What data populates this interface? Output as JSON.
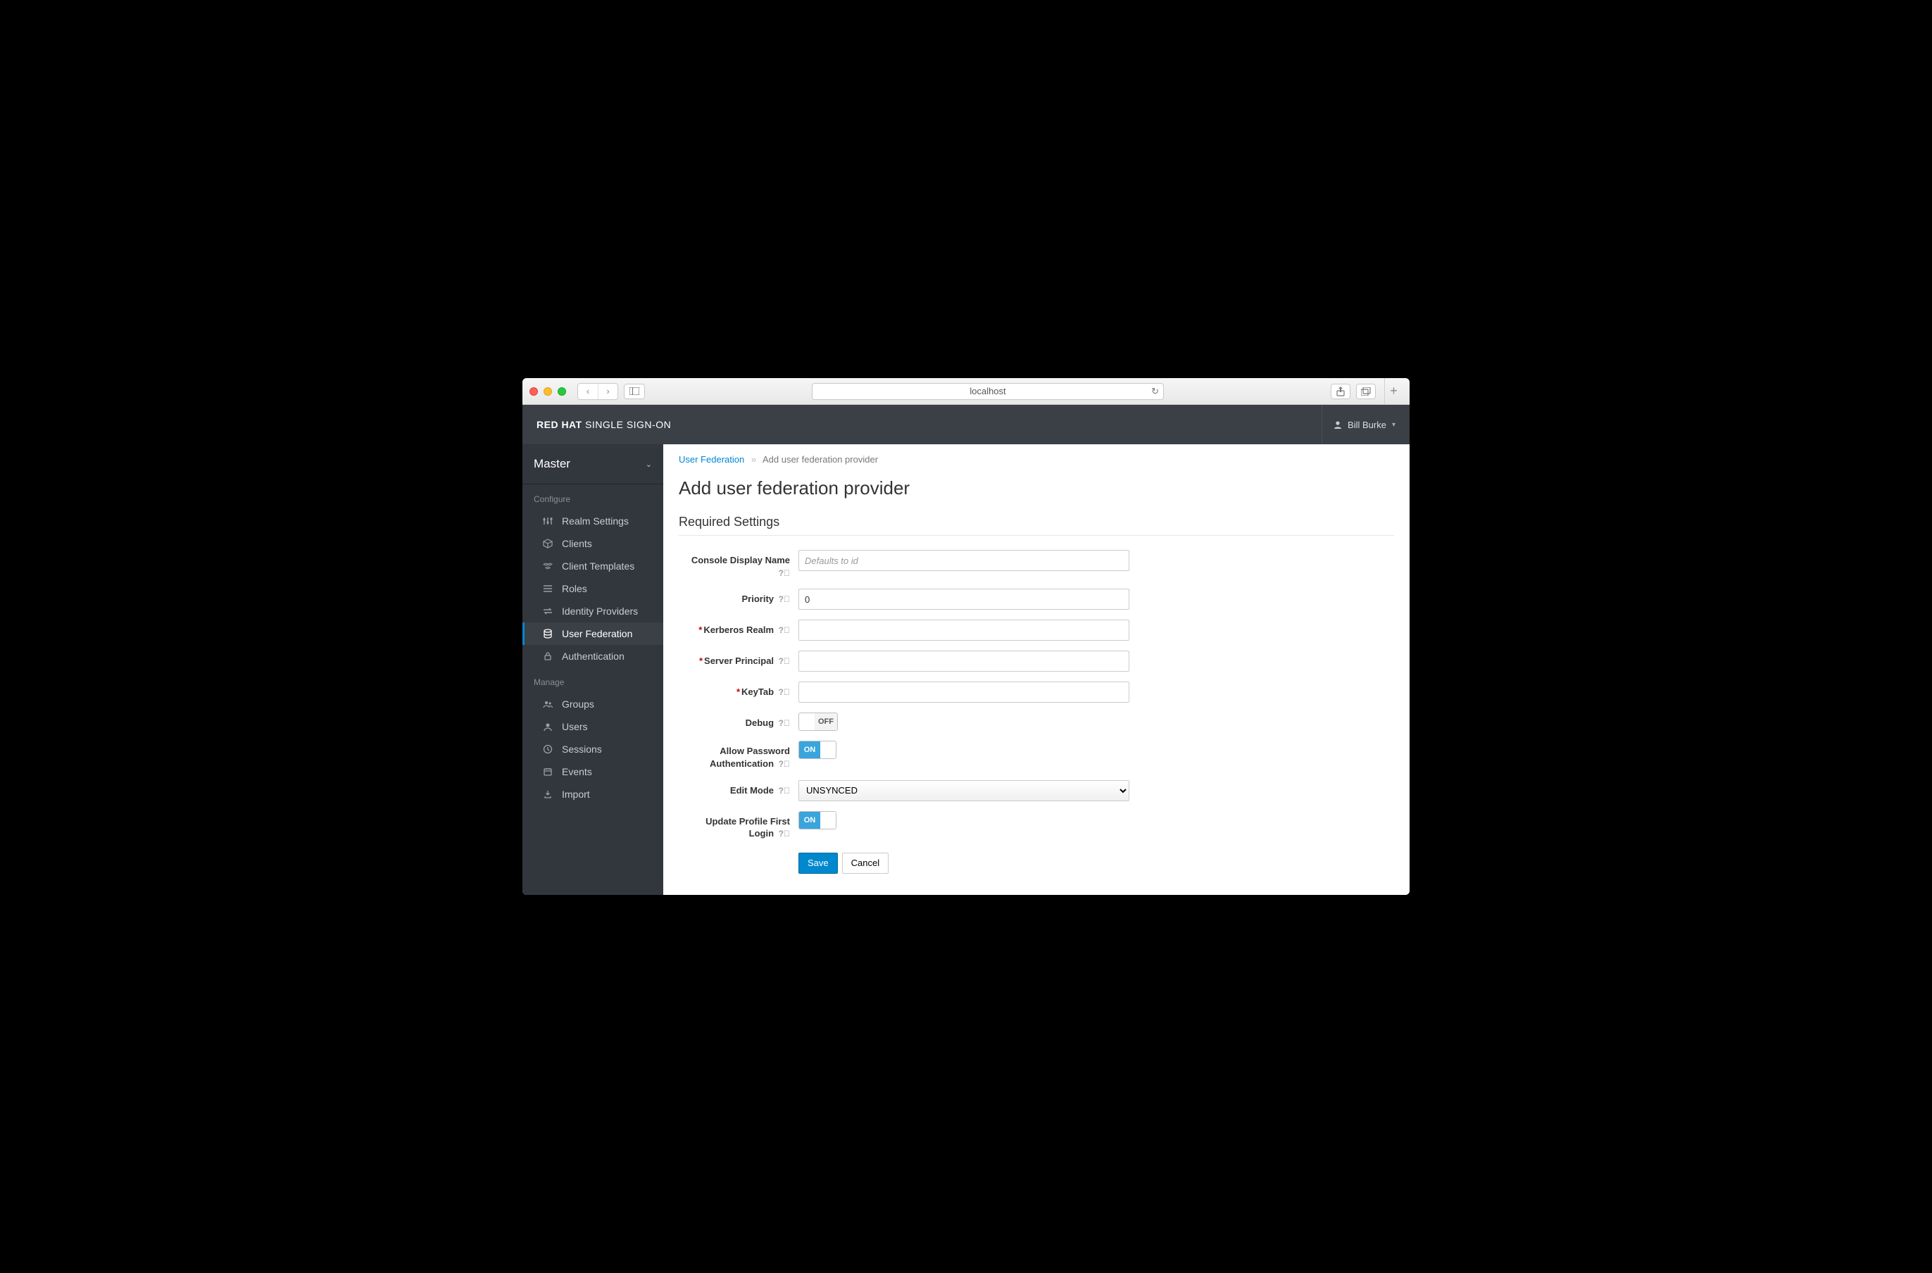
{
  "browser": {
    "url": "localhost"
  },
  "brand": {
    "bold": "RED HAT",
    "rest": " SINGLE SIGN-ON"
  },
  "user": {
    "name": "Bill Burke"
  },
  "realm": {
    "name": "Master"
  },
  "sidebar": {
    "configure_label": "Configure",
    "manage_label": "Manage",
    "configure": [
      {
        "label": "Realm Settings",
        "icon": "sliders"
      },
      {
        "label": "Clients",
        "icon": "cube"
      },
      {
        "label": "Client Templates",
        "icon": "cubes"
      },
      {
        "label": "Roles",
        "icon": "list"
      },
      {
        "label": "Identity Providers",
        "icon": "exchange"
      },
      {
        "label": "User Federation",
        "icon": "database",
        "active": true
      },
      {
        "label": "Authentication",
        "icon": "lock"
      }
    ],
    "manage": [
      {
        "label": "Groups",
        "icon": "group"
      },
      {
        "label": "Users",
        "icon": "user"
      },
      {
        "label": "Sessions",
        "icon": "clock"
      },
      {
        "label": "Events",
        "icon": "calendar"
      },
      {
        "label": "Import",
        "icon": "import"
      }
    ]
  },
  "breadcrumb": {
    "root": "User Federation",
    "current": "Add user federation provider"
  },
  "page": {
    "title": "Add user federation provider",
    "section": "Required Settings"
  },
  "form": {
    "console_display_name": {
      "label": "Console Display Name",
      "placeholder": "Defaults to id",
      "value": ""
    },
    "priority": {
      "label": "Priority",
      "value": "0"
    },
    "kerberos_realm": {
      "label": "Kerberos Realm",
      "value": ""
    },
    "server_principal": {
      "label": "Server Principal",
      "value": ""
    },
    "keytab": {
      "label": "KeyTab",
      "value": ""
    },
    "debug": {
      "label": "Debug",
      "value": "OFF"
    },
    "allow_pw_auth": {
      "label": "Allow Password Authentication",
      "value": "ON"
    },
    "edit_mode": {
      "label": "Edit Mode",
      "value": "UNSYNCED"
    },
    "update_profile": {
      "label": "Update Profile First Login",
      "value": "ON"
    }
  },
  "buttons": {
    "save": "Save",
    "cancel": "Cancel"
  },
  "toggle_text": {
    "on": "ON",
    "off": "OFF"
  }
}
